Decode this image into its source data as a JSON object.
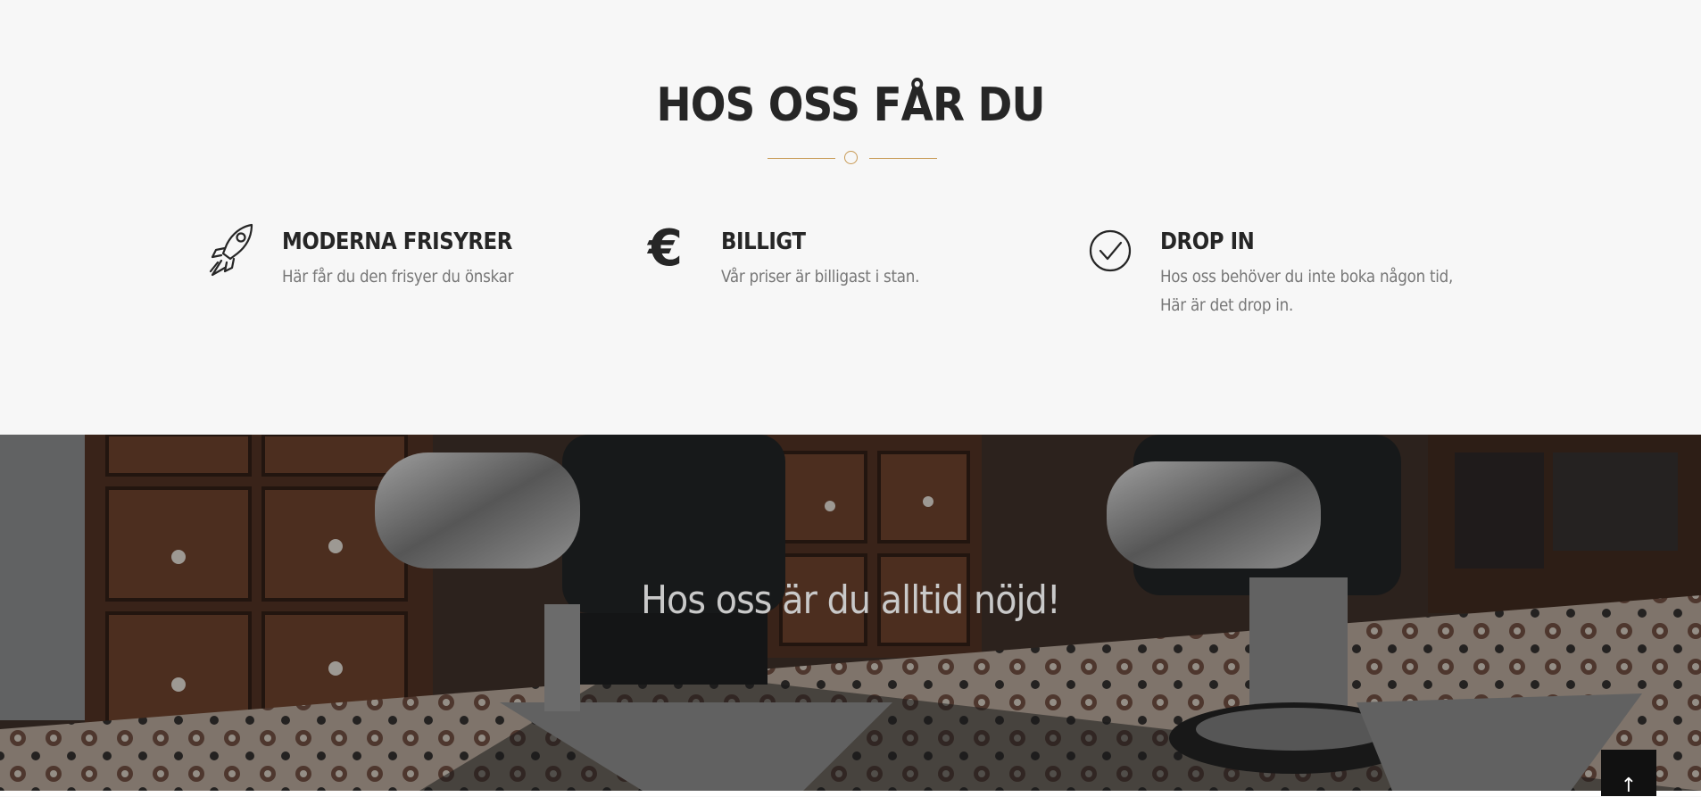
{
  "features_section": {
    "title": "HOS OSS FÅR DU",
    "accent_color": "#c89a55",
    "items": [
      {
        "icon": "rocket-icon",
        "title": "MODERNA FRISYRER",
        "description": "Här får du den frisyer du önskar"
      },
      {
        "icon": "euro-icon",
        "icon_glyph": "€",
        "title": "BILLIGT",
        "description": "Vår priser är billigast i stan."
      },
      {
        "icon": "check-circle-icon",
        "title": "DROP IN",
        "description": "Hos oss behöver du inte boka någon tid, Här är det drop in."
      }
    ]
  },
  "hero": {
    "background": "barbershop-chairs-photo",
    "tagline": "Hos oss är du alltid nöjd!"
  },
  "scroll_top": {
    "icon": "arrow-up-icon",
    "glyph": "↑"
  }
}
